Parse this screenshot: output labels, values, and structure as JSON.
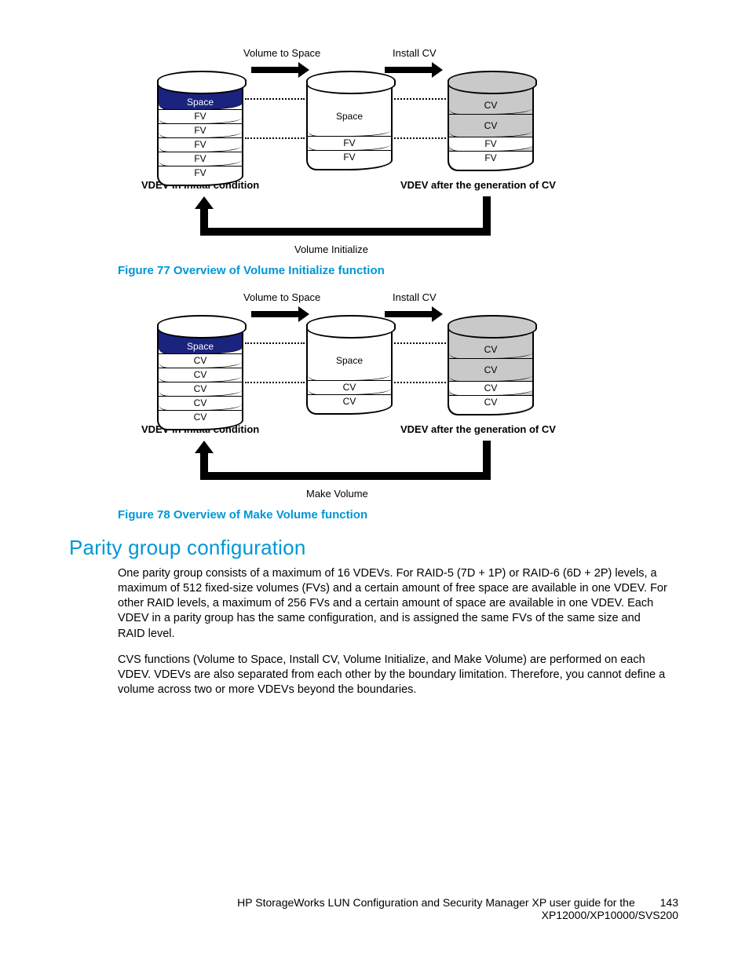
{
  "figures": {
    "fig77": {
      "caption": "Figure 77 Overview of Volume Initialize function",
      "top_labels": {
        "left": "Volume to Space",
        "right": "Install CV"
      },
      "bottom_labels": {
        "left": "VDEV in initial condition",
        "right": "VDEV after the generation of CV"
      },
      "return_label": "Volume Initialize",
      "cyl_left": {
        "top_slice": "Space",
        "rows": [
          "FV",
          "FV",
          "FV",
          "FV",
          "FV"
        ]
      },
      "cyl_mid": {
        "main": "Space",
        "rows": [
          "FV",
          "FV"
        ]
      },
      "cyl_right": {
        "rows_gray": [
          "CV",
          "CV"
        ],
        "rows_white": [
          "FV",
          "FV"
        ]
      }
    },
    "fig78": {
      "caption": "Figure 78 Overview of Make Volume function",
      "top_labels": {
        "left": "Volume to Space",
        "right": "Install CV"
      },
      "bottom_labels": {
        "left": "VDEV in initial condition",
        "right": "VDEV after the generation of CV"
      },
      "return_label": "Make Volume",
      "cyl_left": {
        "top_slice": "Space",
        "rows": [
          "CV",
          "CV",
          "CV",
          "CV",
          "CV"
        ]
      },
      "cyl_mid": {
        "main": "Space",
        "rows": [
          "CV",
          "CV"
        ]
      },
      "cyl_right": {
        "rows_gray": [
          "CV",
          "CV"
        ],
        "rows_white": [
          "CV",
          "CV"
        ]
      }
    }
  },
  "section": {
    "heading": "Parity group configuration",
    "para1": "One parity group consists of a maximum of 16 VDEVs. For RAID-5 (7D + 1P) or RAID-6 (6D + 2P) levels, a maximum of 512 fixed-size volumes (FVs) and a certain amount of free space are available in one VDEV. For other RAID levels, a maximum of 256 FVs and a certain amount of space are available in one VDEV. Each VDEV in a parity group has the same configuration, and is assigned the same FVs of the same size and RAID level.",
    "para2": "CVS functions (Volume to Space, Install CV, Volume Initialize, and Make Volume) are performed on each VDEV. VDEVs are also separated from each other by the boundary limitation. Therefore, you cannot define a volume across two or more VDEVs beyond the boundaries."
  },
  "footer": {
    "line1": "HP StorageWorks LUN Configuration and Security Manager XP user guide for the",
    "line2": "XP12000/XP10000/SVS200",
    "page_number": "143"
  }
}
